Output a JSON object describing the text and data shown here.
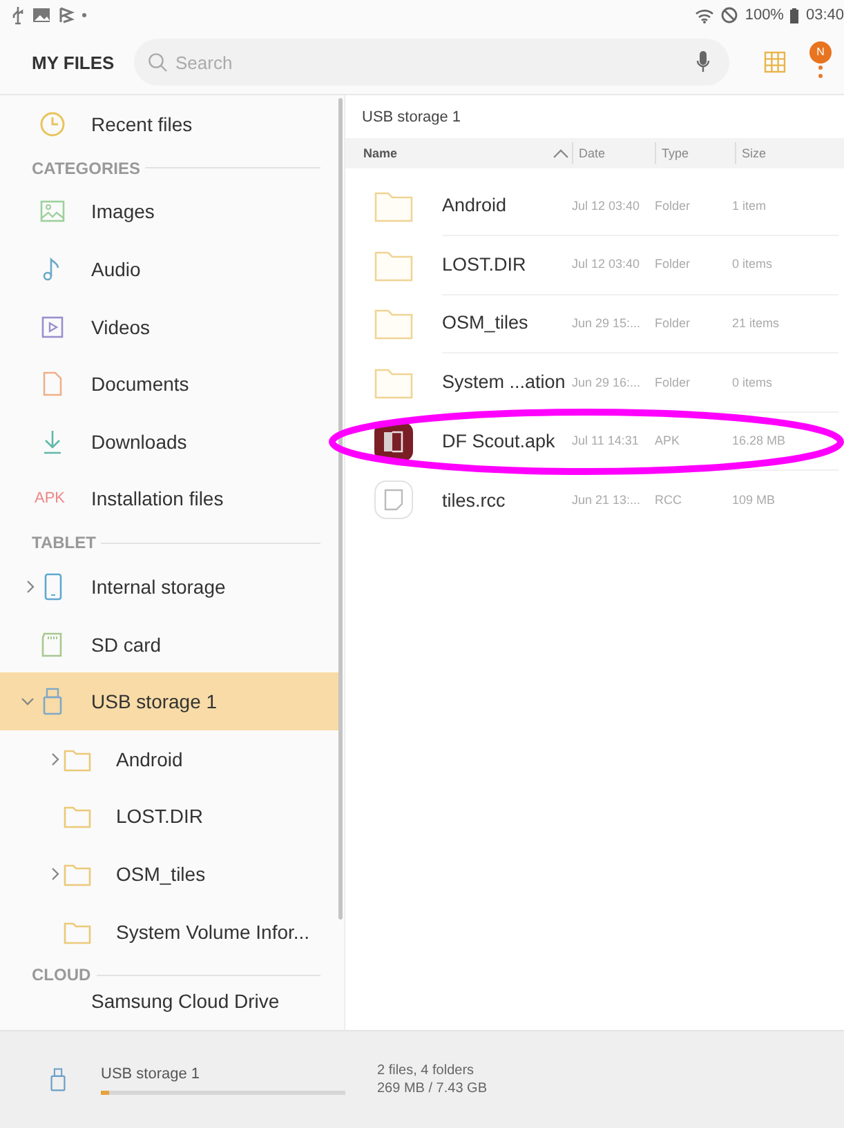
{
  "status_bar": {
    "battery": "100%",
    "time": "03:40"
  },
  "app_bar": {
    "title": "MY FILES",
    "search": {
      "placeholder": "Search"
    },
    "badge": "N"
  },
  "sidebar": {
    "sections": [
      {
        "items": [
          {
            "label": "Recent files",
            "selected": false
          }
        ]
      },
      {
        "header": "CATEGORIES",
        "items": [
          {
            "label": "Images",
            "selected": false
          },
          {
            "label": "Audio",
            "selected": false
          },
          {
            "label": "Videos",
            "selected": false
          },
          {
            "label": "Documents",
            "selected": false
          },
          {
            "label": "Downloads",
            "selected": false
          },
          {
            "label": "Installation files",
            "icon_text": "APK",
            "selected": false
          }
        ]
      },
      {
        "header": "TABLET",
        "items": [
          {
            "label": "Internal storage",
            "expanded": false,
            "selected": false
          },
          {
            "label": "SD card",
            "selected": false
          },
          {
            "label": "USB storage 1",
            "expanded": true,
            "selected": true,
            "children": [
              {
                "label": "Android",
                "expanded": false,
                "selected": false
              },
              {
                "label": "LOST.DIR",
                "selected": false
              },
              {
                "label": "OSM_tiles",
                "expanded": false,
                "selected": false
              },
              {
                "label": "System Volume Infor...",
                "selected": false
              }
            ]
          }
        ]
      },
      {
        "header": "CLOUD",
        "items": [
          {
            "label": "Samsung Cloud Drive",
            "selected": false
          }
        ]
      }
    ]
  },
  "content": {
    "path": "USB storage 1",
    "columns": [
      "Name",
      "Date",
      "Type",
      "Size"
    ],
    "rows": [
      {
        "name": "Android",
        "date": "Jul 12 03:40",
        "type": "Folder",
        "size": "1 item",
        "kind": "folder",
        "circled": false
      },
      {
        "name": "LOST.DIR",
        "date": "Jul 12 03:40",
        "type": "Folder",
        "size": "0 items",
        "kind": "folder",
        "circled": false
      },
      {
        "name": "OSM_tiles",
        "date": "Jun 29 15:...",
        "type": "Folder",
        "size": "21 items",
        "kind": "folder",
        "circled": false
      },
      {
        "name": "System ...ation",
        "date": "Jun 29 16:...",
        "type": "Folder",
        "size": "0 items",
        "kind": "folder",
        "circled": false
      },
      {
        "name": "DF Scout.apk",
        "date": "Jul 11 14:31",
        "type": "APK",
        "size": "16.28 MB",
        "kind": "app",
        "circled": true
      },
      {
        "name": "tiles.rcc",
        "date": "Jun 21 13:...",
        "type": "RCC",
        "size": "109 MB",
        "kind": "file",
        "circled": false
      }
    ]
  },
  "storage_bar": {
    "name": "USB storage 1",
    "level": 0.035,
    "summary": "2 files, 4 folders",
    "usage": "269 MB / 7.43 GB"
  }
}
